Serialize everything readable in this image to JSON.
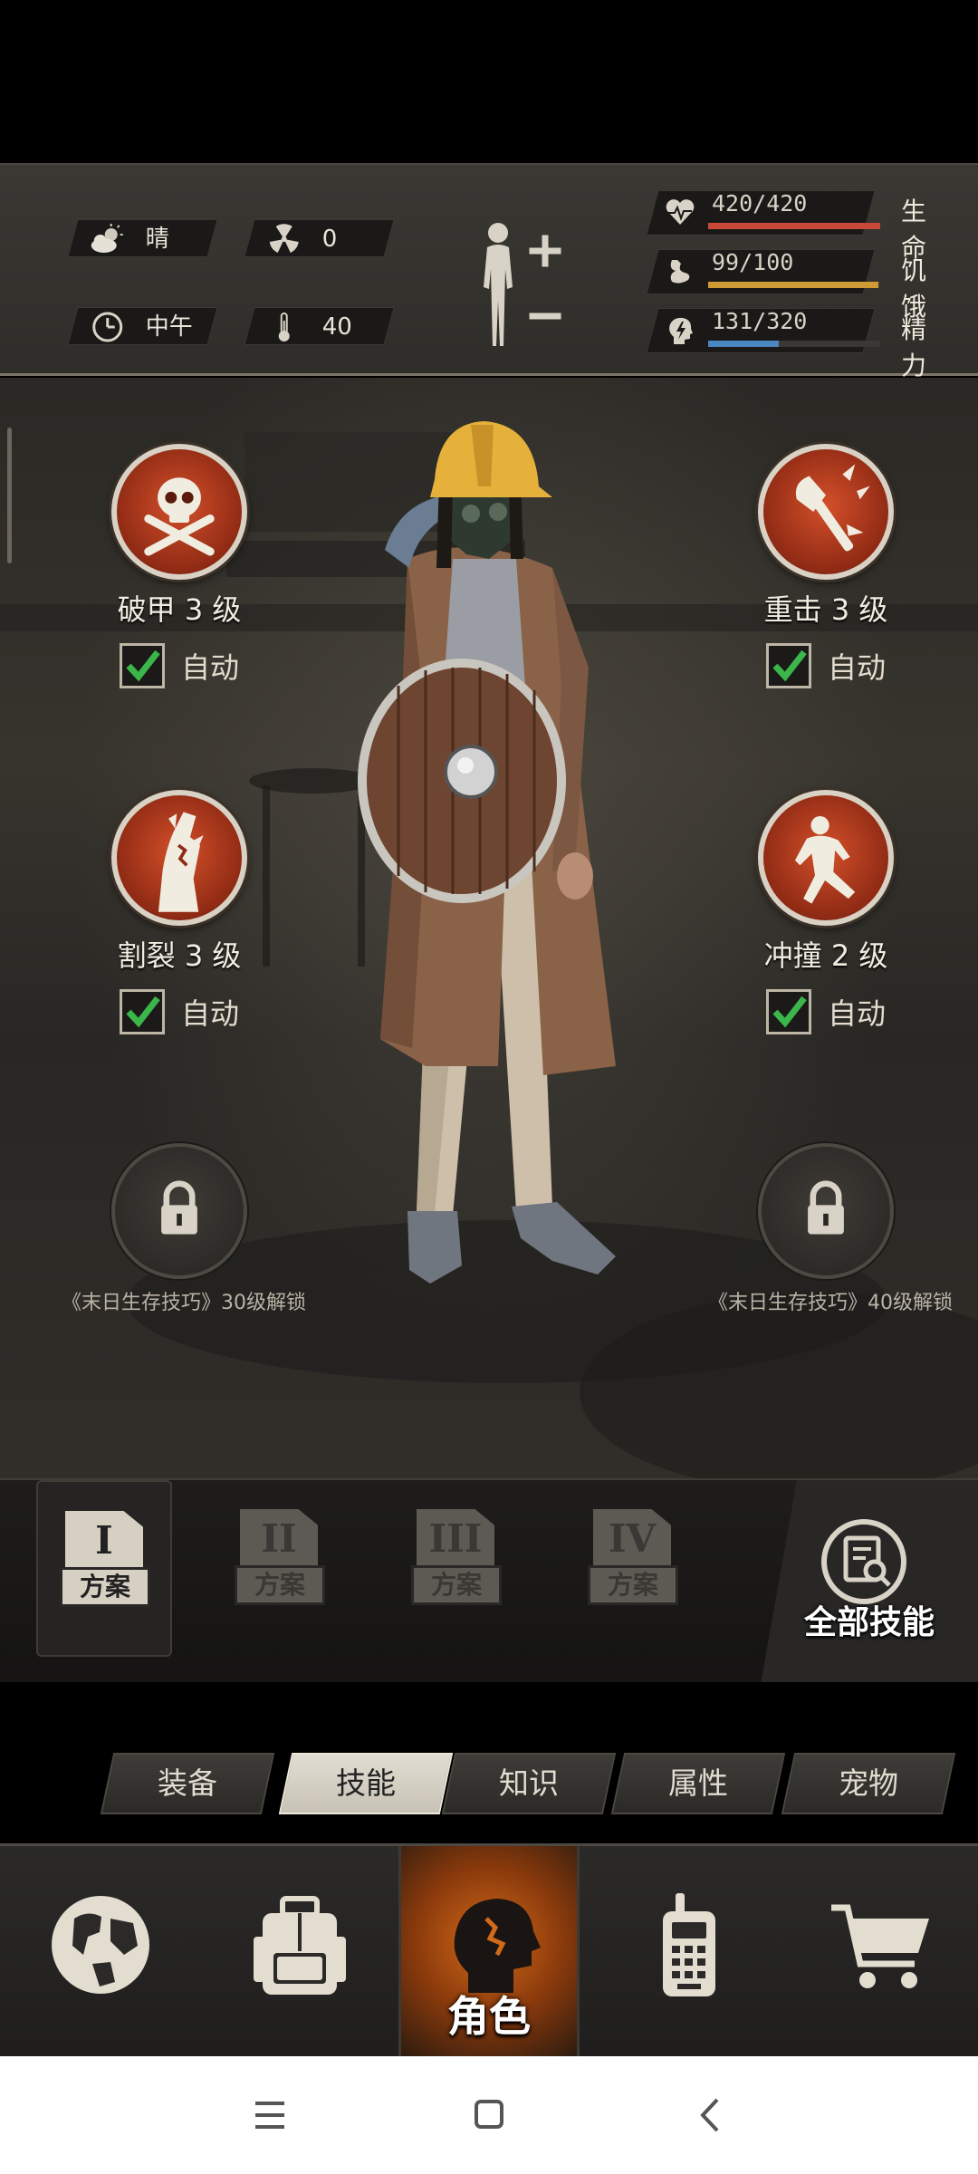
{
  "status": {
    "weather": "晴",
    "radiation": "0",
    "time_of_day": "中午",
    "temperature": "40"
  },
  "vitals": [
    {
      "value": "420/420",
      "label": "生命",
      "fraction": 1.0,
      "color": "#c8483a",
      "icon": "heart-icon"
    },
    {
      "value": "99/100",
      "label": "饥饿",
      "fraction": 0.99,
      "color": "#d09a35",
      "icon": "stomach-icon"
    },
    {
      "value": "131/320",
      "label": "精力",
      "fraction": 0.41,
      "color": "#4a86c0",
      "icon": "energy-head-icon"
    }
  ],
  "skills": {
    "left": [
      {
        "name": "破甲 3 级",
        "auto": "自动",
        "checked": true,
        "icon": "skull-crossbones-icon"
      },
      {
        "name": "割裂 3 级",
        "auto": "自动",
        "checked": true,
        "icon": "torn-flesh-icon"
      },
      {
        "unlock": "《末日生存技巧》30级解锁",
        "icon": "lock-icon"
      }
    ],
    "right": [
      {
        "name": "重击 3 级",
        "auto": "自动",
        "checked": true,
        "icon": "axe-smash-icon"
      },
      {
        "name": "冲撞 2 级",
        "auto": "自动",
        "checked": true,
        "icon": "charge-man-icon"
      },
      {
        "unlock": "《末日生存技巧》40级解锁",
        "icon": "lock-icon"
      }
    ]
  },
  "plans": [
    {
      "numeral": "I",
      "label": "方案",
      "active": true
    },
    {
      "numeral": "II",
      "label": "方案",
      "active": false
    },
    {
      "numeral": "III",
      "label": "方案",
      "active": false
    },
    {
      "numeral": "IV",
      "label": "方案",
      "active": false
    }
  ],
  "all_skills_label": "全部技能",
  "subtabs": [
    "装备",
    "技能",
    "知识",
    "属性",
    "宠物"
  ],
  "active_subtab": "技能",
  "bottom_nav": {
    "active_label": "角色",
    "items": [
      "globe-icon",
      "backpack-icon",
      "character-head-icon",
      "walkie-talkie-icon",
      "shopping-cart-icon"
    ]
  }
}
